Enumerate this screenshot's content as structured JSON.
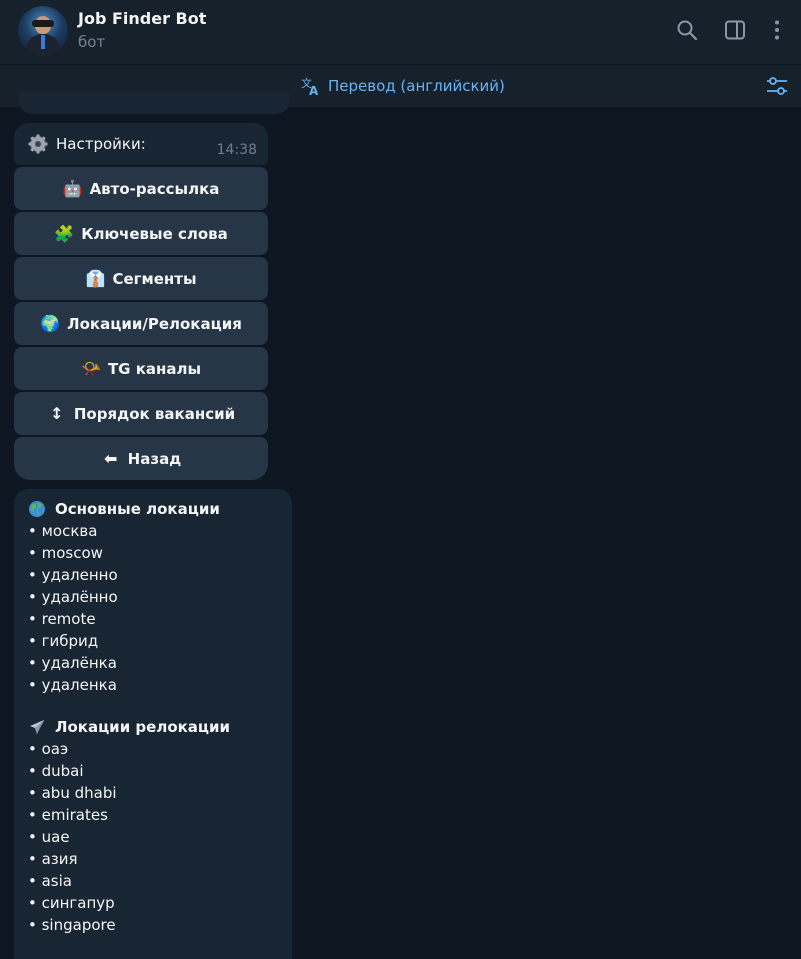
{
  "header": {
    "title": "Job Finder Bot",
    "subtitle": "бот",
    "icons": [
      "search-icon",
      "sidebar-toggle-icon",
      "more-vertical-icon"
    ]
  },
  "translate_bar": {
    "label": "Перевод (английский)",
    "icon": "translate-icon",
    "settings_icon": "tune-icon"
  },
  "settings_message": {
    "text": "Настройки:",
    "icon": "gear-icon",
    "time": "14:38"
  },
  "keyboard": [
    {
      "label": "Авто-рассылка",
      "emoji": "🤖"
    },
    {
      "label": "Ключевые слова",
      "emoji": "🧩"
    },
    {
      "label": "Сегменты",
      "emoji": "👔"
    },
    {
      "label": "Локации/Релокация",
      "emoji": "🌍"
    },
    {
      "label": "TG каналы",
      "emoji": "📯"
    },
    {
      "label": "Порядок вакансий",
      "emoji": "↕"
    },
    {
      "label": "Назад",
      "emoji": "⬅"
    }
  ],
  "locations_message": {
    "main_title": "Основные локации",
    "main_icon": "globe-icon",
    "main_items": [
      "• москва",
      "• moscow",
      "• удаленно",
      "• удалённо",
      "• remote",
      "• гибрид",
      "• удалёнка",
      "• удаленка"
    ],
    "relocation_title": "Локации релокации",
    "relocation_icon": "airplane-icon",
    "relocation_items": [
      "• оаэ",
      "• dubai",
      "• abu dhabi",
      "• emirates",
      "• uae",
      "• азия",
      "• asia",
      "• сингапур",
      "• singapore"
    ]
  },
  "colors": {
    "background": "#0e1621",
    "header": "#17212b",
    "bubble": "#182533",
    "button": "#263647",
    "accent": "#6ab3f3",
    "secondary_text": "#708499"
  }
}
